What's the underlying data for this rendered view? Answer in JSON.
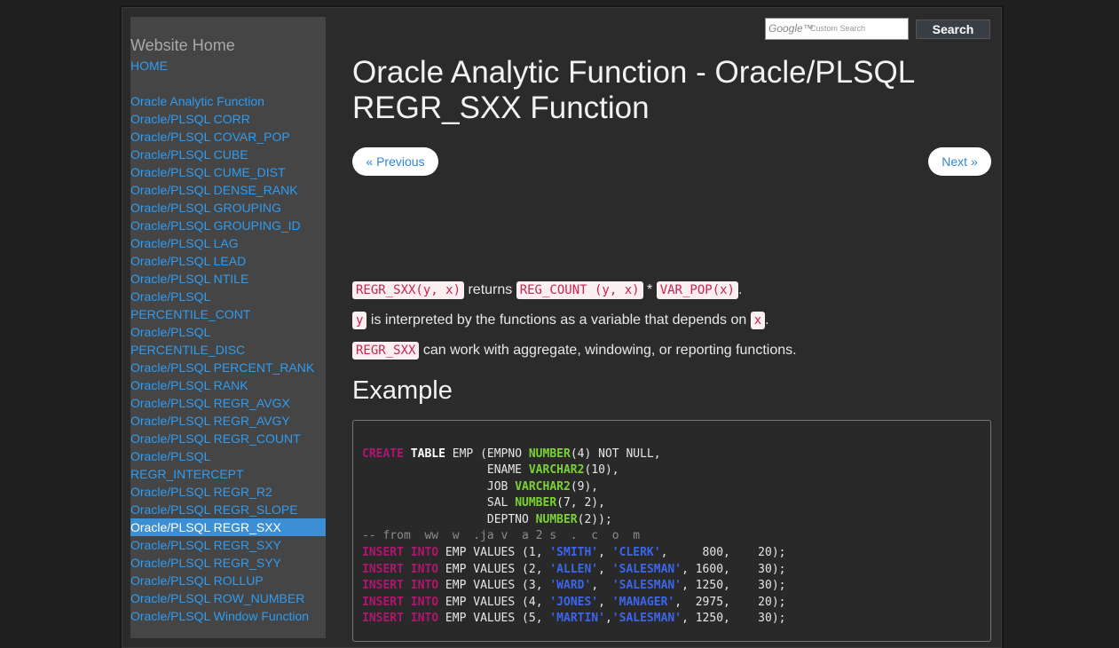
{
  "search": {
    "logo_text": "Google™",
    "placeholder": "Custom Search",
    "button_label": "Search"
  },
  "sidebar": {
    "title": "Website Home",
    "home": "HOME",
    "items": [
      "Oracle Analytic Function",
      "Oracle/PLSQL CORR",
      "Oracle/PLSQL COVAR_POP",
      "Oracle/PLSQL CUBE",
      "Oracle/PLSQL CUME_DIST",
      "Oracle/PLSQL DENSE_RANK",
      "Oracle/PLSQL GROUPING",
      "Oracle/PLSQL GROUPING_ID",
      "Oracle/PLSQL LAG",
      "Oracle/PLSQL LEAD",
      "Oracle/PLSQL NTILE",
      "Oracle/PLSQL",
      "PERCENTILE_CONT",
      "Oracle/PLSQL",
      "PERCENTILE_DISC",
      "Oracle/PLSQL PERCENT_RANK",
      "Oracle/PLSQL RANK",
      "Oracle/PLSQL REGR_AVGX",
      "Oracle/PLSQL REGR_AVGY",
      "Oracle/PLSQL REGR_COUNT",
      "Oracle/PLSQL",
      "REGR_INTERCEPT",
      "Oracle/PLSQL REGR_R2",
      "Oracle/PLSQL REGR_SLOPE",
      "Oracle/PLSQL REGR_SXX",
      "Oracle/PLSQL REGR_SXY",
      "Oracle/PLSQL REGR_SYY",
      "Oracle/PLSQL ROLLUP",
      "Oracle/PLSQL ROW_NUMBER",
      "Oracle/PLSQL Window Function"
    ]
  },
  "page": {
    "title_line1": "Oracle Analytic Function - Oracle/PLSQL",
    "title_line2": "REGR_SXX Function",
    "prev_label": "« Previous",
    "next_label": "Next »"
  },
  "content": {
    "p1": {
      "c1": "REGR_SXX(y, x)",
      "t1": " returns ",
      "c2": "REG_COUNT (y, x)",
      "t2": " * ",
      "c3": "VAR_POP(x)",
      "t3": "."
    },
    "p2": {
      "c1": "y",
      "t1": " is interpreted by the functions as a variable that depends on ",
      "c2": "x",
      "t2": "."
    },
    "p3": {
      "c1": "REGR_SXX",
      "t1": " can work with aggregate, windowing, or reporting functions."
    },
    "example_heading": "Example"
  },
  "code": {
    "l1": {
      "a": "CREATE",
      "b": " ",
      "c": "TABLE",
      "d": " EMP (EMPNO ",
      "e": "NUMBER",
      "f": "(4) NOT NULL,"
    },
    "l2": {
      "a": "                  ENAME ",
      "b": "VARCHAR2",
      "c": "(10),"
    },
    "l3": {
      "a": "                  JOB ",
      "b": "VARCHAR2",
      "c": "(9),"
    },
    "l4": {
      "a": "                  SAL ",
      "b": "NUMBER",
      "c": "(7, 2),"
    },
    "l5": {
      "a": "                  DEPTNO ",
      "b": "NUMBER",
      "c": "(2));"
    },
    "l6": "-- from  ww  w  .ja v  a 2 s  .  c  o  m",
    "rows": [
      {
        "n": "1",
        "name": "'SMITH'",
        "sep": ", ",
        "job": "'CLERK'",
        "tail": ",     800,    20);"
      },
      {
        "n": "2",
        "name": "'ALLEN'",
        "sep": ", ",
        "job": "'SALESMAN'",
        "tail": ", 1600,    30);"
      },
      {
        "n": "3",
        "name": "'WARD'",
        "sep": ",  ",
        "job": "'SALESMAN'",
        "tail": ", 1250,    30);"
      },
      {
        "n": "4",
        "name": "'JONES'",
        "sep": ", ",
        "job": "'MANAGER'",
        "tail": ",  2975,    20);"
      },
      {
        "n": "5",
        "name": "'MARTIN'",
        "sep": ",",
        "job": "'SALESMAN'",
        "tail": ", 1250,    30);"
      }
    ],
    "insert_kw": "INSERT",
    "into_kw": "INTO",
    "values_prefix": " EMP VALUES ("
  }
}
